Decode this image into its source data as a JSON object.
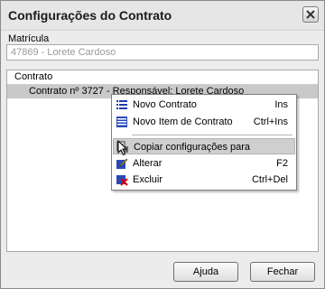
{
  "window": {
    "title": "Configurações do Contrato"
  },
  "matricula": {
    "label": "Matrícula",
    "value": "47869 - Lorete Cardoso"
  },
  "tree": {
    "header": "Contrato",
    "selected_row": "Contrato nº 3727 - Responsável: Lorete Cardoso"
  },
  "context_menu": {
    "items": [
      {
        "label": "Novo Contrato",
        "shortcut": "Ins",
        "icon": "list-icon"
      },
      {
        "label": "Novo Item de Contrato",
        "shortcut": "Ctrl+Ins",
        "icon": "list-add-icon"
      },
      {
        "label": "Copiar configurações para",
        "shortcut": "",
        "icon": "copy-settings-icon"
      },
      {
        "label": "Alterar",
        "shortcut": "F2",
        "icon": "edit-icon"
      },
      {
        "label": "Excluir",
        "shortcut": "Ctrl+Del",
        "icon": "delete-icon"
      }
    ],
    "highlighted_item": "Copiar configurações para"
  },
  "buttons": {
    "help": "Ajuda",
    "close": "Fechar"
  },
  "colors": {
    "highlight": "#cfcfcf",
    "selected_row": "#c9c9c9",
    "icon_blue": "#1c3fa8"
  }
}
